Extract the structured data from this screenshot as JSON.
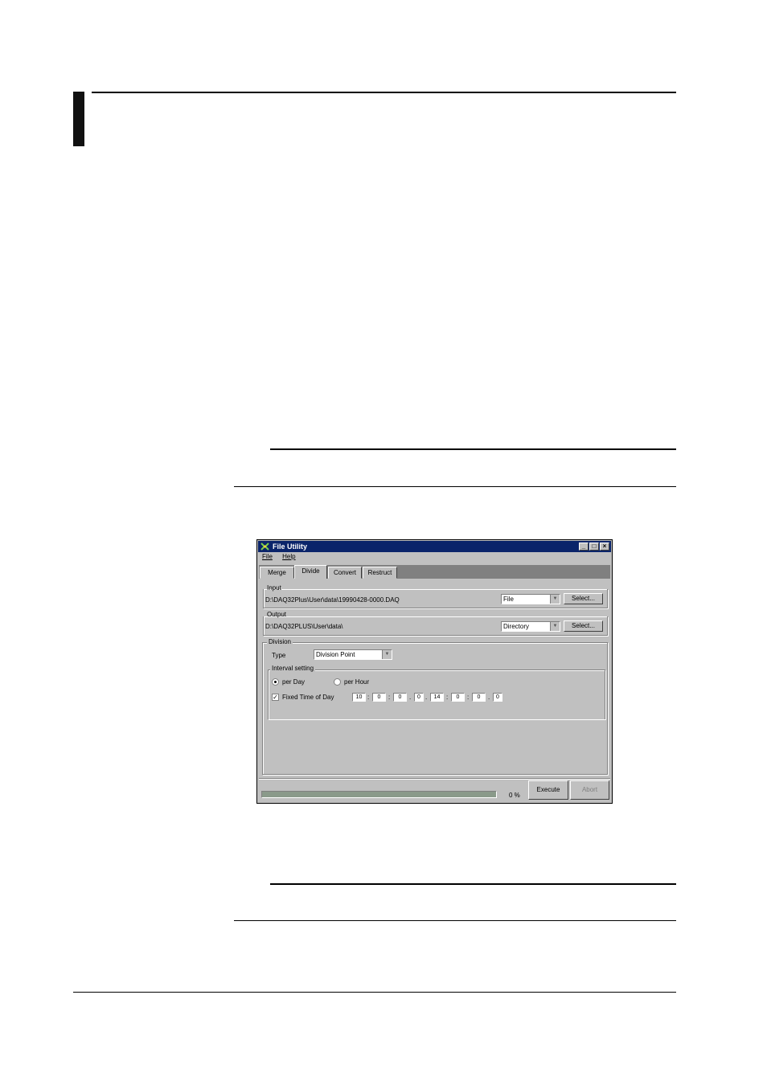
{
  "window": {
    "title": "File Utility",
    "menu": [
      "File",
      "Help"
    ],
    "tabs": [
      "Merge",
      "Divide",
      "Convert",
      "Restruct"
    ],
    "input": {
      "label": "Input",
      "path": "D:\\DAQ32Plus\\User\\data\\19990428-0000.DAQ",
      "type_value": "File",
      "select_label": "Select..."
    },
    "output": {
      "label": "Output",
      "path": "D:\\DAQ32PLUS\\User\\data\\",
      "type_value": "Directory",
      "select_label": "Select..."
    },
    "division": {
      "label": "Division",
      "type_label": "Type",
      "type_value": "Division Point",
      "interval_label": "Interval setting",
      "per_day_label": "per Day",
      "per_hour_label": "per Hour",
      "fixed_label": "Fixed Time of Day",
      "fixed_checked": true,
      "time_fields": [
        "10",
        "0",
        "0",
        "0",
        "14",
        "0",
        "0",
        "0"
      ],
      "separators": [
        ":",
        ":",
        ".",
        ".",
        ":",
        ":",
        "."
      ]
    },
    "footer": {
      "progress_text": "0 %",
      "progress": 0,
      "execute_label": "Execute",
      "abort_label": "Abort"
    }
  }
}
